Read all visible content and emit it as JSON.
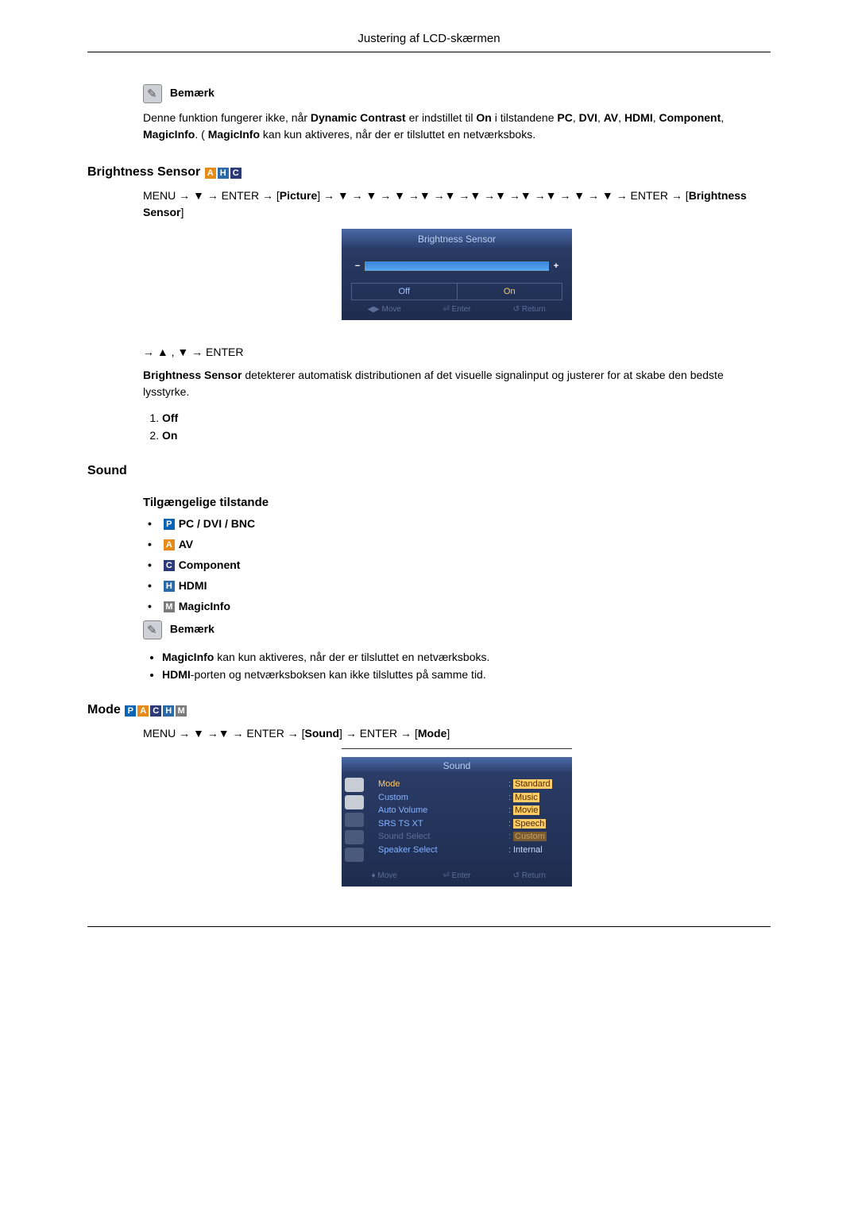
{
  "page_header": "Justering af LCD-skærmen",
  "note1": {
    "heading": "Bemærk",
    "text_before": "Denne funktion fungerer ikke, når ",
    "dc": "Dynamic Contrast",
    "mid1": " er indstillet til ",
    "on": "On",
    "mid2": " i tilstandene ",
    "pc": "PC",
    "dvi": "DVI",
    "av": "AV",
    "hdmi": "HDMI",
    "comp": "Component",
    "magic": "MagicInfo",
    "mid3": ". ( ",
    "magic2": "MagicInfo",
    "tail": " kan kun aktiveres, når der er tilsluttet en netværksboks."
  },
  "brightness": {
    "title": "Brightness Sensor",
    "badges": [
      "A",
      "H",
      "C"
    ],
    "menu_path_prefix": "MENU → ▼ → ENTER → [",
    "picture": "Picture",
    "menu_path_mid": "] → ▼ → ▼ → ▼ →▼ →▼ →▼ →▼ →▼ →▼ → ▼ → ▼ → ENTER → [",
    "bs_label": "Brightness Sensor",
    "menu_path_suffix": "]",
    "arrows2": "→ ▲ , ▼ → ENTER",
    "desc_strong": "Brightness Sensor",
    "desc": " detekterer automatisk distributionen af det visuelle signalinput og justerer for at skabe den bedste lysstyrke.",
    "option1": "Off",
    "option2": "On",
    "osd": {
      "title": "Brightness Sensor",
      "off": "Off",
      "on": "On",
      "move": "◀▶ Move",
      "enter": "⏎ Enter",
      "return": "↺ Return"
    }
  },
  "sound": {
    "title": "Sound",
    "sub": "Tilgængelige tilstande",
    "modes": {
      "p": "PC / DVI / BNC",
      "a": "AV",
      "c": "Component",
      "h": "HDMI",
      "m": "MagicInfo"
    },
    "note": {
      "heading": "Bemærk",
      "li1_b": "MagicInfo",
      "li1_t": " kan kun aktiveres, når der er tilsluttet en netværksboks.",
      "li2_b": "HDMI",
      "li2_t": "-porten og netværksboksen kan ikke tilsluttes på samme tid."
    }
  },
  "mode": {
    "title": "Mode",
    "badges": [
      "P",
      "A",
      "C",
      "H",
      "M"
    ],
    "menu_path": "MENU → ▼ →▼ → ENTER → [",
    "sound_label": "Sound",
    "menu_path_mid": "] → ENTER → [",
    "mode_label": "Mode",
    "menu_path_end": "]",
    "osd": {
      "title": "Sound",
      "rows": [
        {
          "label": "Mode",
          "value": "Standard",
          "hl_label": true,
          "hl_value": true
        },
        {
          "label": "Custom",
          "value": "Music"
        },
        {
          "label": "Auto Volume",
          "value": "Movie"
        },
        {
          "label": "SRS TS XT",
          "value": "Speech"
        },
        {
          "label": "Sound Select",
          "value": "Custom",
          "dim_label": true,
          "dim_value": true
        },
        {
          "label": "Speaker Select",
          "value": "Internal",
          "value_class": "internal"
        }
      ],
      "move": "♦ Move",
      "enter": "⏎ Enter",
      "return": "↺ Return"
    }
  }
}
